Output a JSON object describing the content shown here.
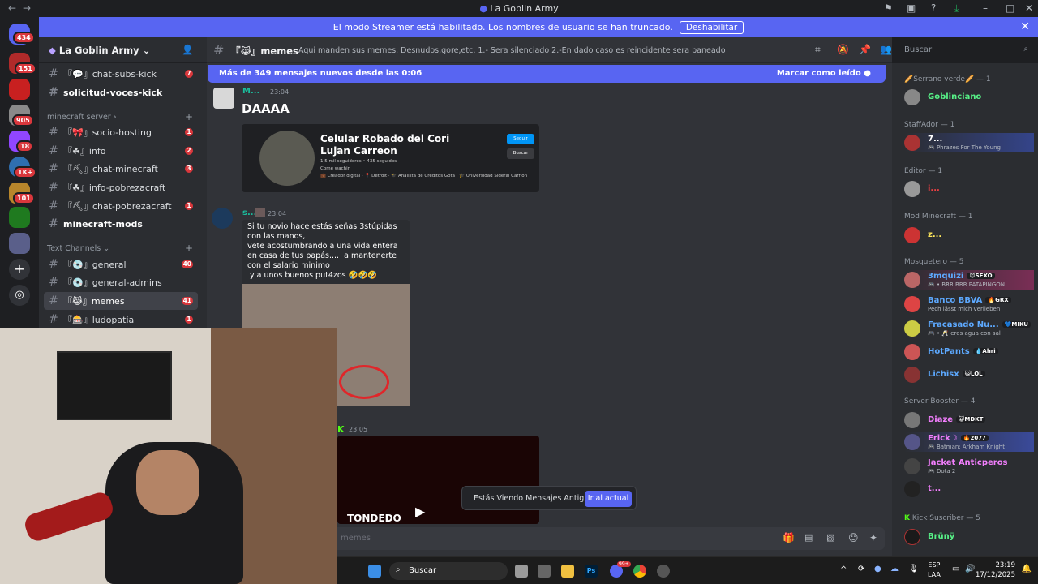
{
  "window": {
    "title": "La Goblin Army"
  },
  "banner": {
    "text": "El modo Streamer está habilitado. Los nombres de usuario se han truncado.",
    "button": "Deshabilitar"
  },
  "rail": {
    "badges": [
      "434",
      "151",
      "905",
      "18",
      "1K+",
      "101"
    ]
  },
  "server": {
    "name": "La Goblin Army"
  },
  "sidebar": {
    "channels_top": [
      {
        "name": "『💬』chat-subs-kick",
        "count": "7"
      },
      {
        "name": "solicitud-voces-kick",
        "count": ""
      }
    ],
    "cat_minecraft": "minecraft server",
    "minecraft": [
      {
        "name": "『🎀』socio-hosting",
        "count": "1"
      },
      {
        "name": "『☘』info",
        "count": "2"
      },
      {
        "name": "『⛏』chat-minecraft",
        "count": "3"
      },
      {
        "name": "『☘』info-pobrezacraft",
        "count": "1"
      },
      {
        "name": "『⛏』chat-pobrezacraft",
        "count": "1"
      },
      {
        "name": "minecraft-mods",
        "count": ""
      }
    ],
    "cat_text": "Text Channels",
    "text": [
      {
        "name": "『💿』general",
        "count": "40"
      },
      {
        "name": "『💿』general-admins",
        "count": ""
      },
      {
        "name": "『😹』memes",
        "count": "41"
      },
      {
        "name": "『🎰』ludopatia",
        "count": "1"
      }
    ]
  },
  "channel": {
    "name": "『😹』memes",
    "topic": "Aqui manden sus memes. Desnudos,gore,etc. 1.- Sera silenciado 2.-En dado caso es reincidente sera baneado",
    "search_placeholder": "Buscar"
  },
  "newbar": {
    "text": "Más de 349 mensajes nuevos desde las 0:06",
    "mark": "Marcar como leído"
  },
  "messages": [
    {
      "author": "M...",
      "time": "23:04",
      "text": "DAAAA",
      "embed": {
        "title": "Celular Robado del Cori Lujan Carreon",
        "stats": "1,5 mil seguidores • 435 seguidos",
        "bio": "Come wachin",
        "meta": "💼 Creador digital · 📍 Detroit · 🎓 Analista de Créditos Gota · 🎓 Universidad Sideral Carrion",
        "follow": "Seguir",
        "search": "Buscar"
      }
    },
    {
      "author": "s...",
      "time": "23:04",
      "text": "Si tu novio hace estás señas 3stúpidas con las manos,\nvete acostumbrando a una vida entera en casa de tus papás....  a mantenerte con el salario minimo\n y a unos buenos put4zos 🤣🤣🤣"
    },
    {
      "author": "",
      "time": "23:05",
      "video_text": "TONDEDO"
    }
  ],
  "toast": {
    "label": "Estás Viendo Mensajes Antiguos",
    "button": "Ir al actual"
  },
  "composer": {
    "placeholder": "memes"
  },
  "members": [
    {
      "cat": "🥖Serrano verde🥖 — 1",
      "rows": [
        {
          "name": "Goblinciano",
          "status": "",
          "color": "#57f287",
          "tag": ""
        }
      ]
    },
    {
      "cat": "StaffAdor — 1",
      "rows": [
        {
          "name": "7...",
          "status": "🎮 Phrazes For The Young",
          "color": "#ffffff",
          "tag": ""
        }
      ]
    },
    {
      "cat": "Editor — 1",
      "rows": [
        {
          "name": "i...",
          "status": "",
          "color": "#f23f43",
          "tag": ""
        }
      ]
    },
    {
      "cat": "Mod Minecraft — 1",
      "rows": [
        {
          "name": "z...",
          "status": "",
          "color": "#fee75c",
          "tag": ""
        }
      ]
    },
    {
      "cat": "Mosquetero — 5",
      "rows": [
        {
          "name": "3mquizi",
          "status": "🎮 • BRR BRR PATAPINGON",
          "color": "#5da9ff",
          "tag": "😈SEXO"
        },
        {
          "name": "Banco BBVA",
          "status": "Pech lässt mich verlieben",
          "color": "#5da9ff",
          "tag": "🔥GRX"
        },
        {
          "name": "Fracasado Nu...",
          "status": "🎮 • 🥂 eres agua con sal",
          "color": "#5da9ff",
          "tag": "💙MIKU"
        },
        {
          "name": "HotPants",
          "status": "",
          "color": "#5da9ff",
          "tag": "💧Ahri"
        },
        {
          "name": "Lichisx",
          "status": "",
          "color": "#5da9ff",
          "tag": "😺LOL"
        }
      ]
    },
    {
      "cat": "Server Booster — 4",
      "rows": [
        {
          "name": "Diaze",
          "status": "",
          "color": "#f47fff",
          "tag": "😺MDKT"
        },
        {
          "name": "Erick☽",
          "status": "🎮 Batman: Arkham Knight",
          "color": "#f47fff",
          "tag": "🔥2077"
        },
        {
          "name": "Jacket Anticperos",
          "status": "🎮 Dota 2",
          "color": "#f47fff",
          "tag": ""
        },
        {
          "name": "t...",
          "status": "",
          "color": "#f47fff",
          "tag": ""
        }
      ]
    },
    {
      "cat": "Kick Suscriber — 5",
      "rows": [
        {
          "name": "Brünÿ",
          "status": "",
          "color": "#57f287",
          "tag": ""
        }
      ]
    }
  ],
  "taskbar": {
    "search": "Buscar",
    "lang1": "ESP",
    "lang2": "LAA",
    "time": "23:19",
    "date": "17/12/2025",
    "discord_badge": "99+"
  },
  "colors": {
    "accent": "#5865f2",
    "bg": "#313338",
    "sidebar": "#2b2d31",
    "rail": "#1e1f22",
    "red": "#da373c"
  }
}
